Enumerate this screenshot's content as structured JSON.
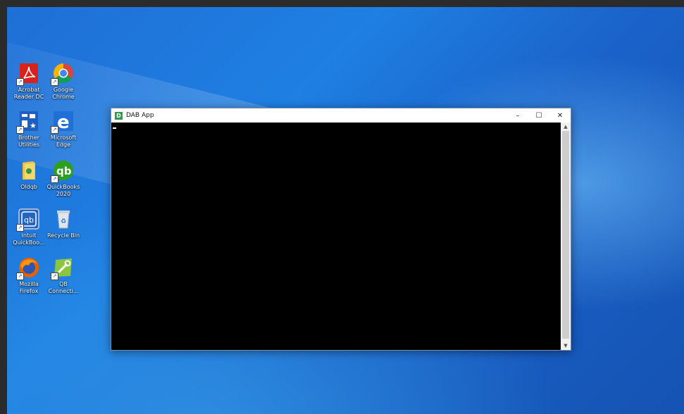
{
  "desktop": {
    "icons": [
      {
        "label": "Acrobat\nReader DC",
        "icon": "acrobat-icon"
      },
      {
        "label": "Google\nChrome",
        "icon": "chrome-icon"
      },
      {
        "label": "Brother\nUtilities",
        "icon": "brother-utilities-icon"
      },
      {
        "label": "Microsoft\nEdge",
        "icon": "edge-icon"
      },
      {
        "label": "Oldqb",
        "icon": "folder-icon"
      },
      {
        "label": "QuickBooks\n2020",
        "icon": "quickbooks-icon"
      },
      {
        "label": "Intuit\nQuickBoo...",
        "icon": "intuit-quickbooks-icon"
      },
      {
        "label": "Recycle Bin",
        "icon": "recycle-bin-icon"
      },
      {
        "label": "Mozilla\nFirefox",
        "icon": "firefox-icon"
      },
      {
        "label": "QB\nConnecti...",
        "icon": "qb-connector-icon"
      }
    ]
  },
  "window": {
    "title": "DAB App",
    "app_icon_letter": "D",
    "minimize": "–",
    "maximize": "☐",
    "close": "✕",
    "scroll_up": "▲",
    "scroll_down": "▼"
  },
  "colors": {
    "console_bg": "#000000",
    "app_icon": "#2e9b4a"
  }
}
